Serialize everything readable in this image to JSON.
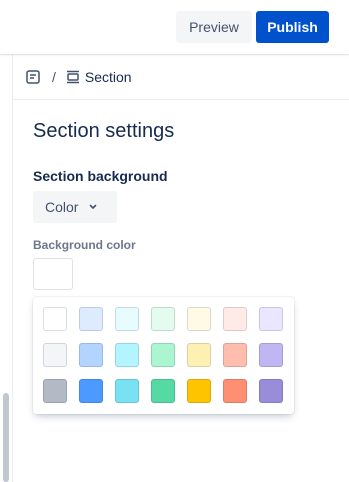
{
  "toolbar": {
    "preview_label": "Preview",
    "publish_label": "Publish"
  },
  "breadcrumb": {
    "page_icon": "page-icon",
    "separator": "/",
    "section_icon": "section-icon",
    "section_label": "Section"
  },
  "panel": {
    "title": "Section settings",
    "background_heading": "Section background",
    "background_type": "Color",
    "background_color_label": "Background color"
  },
  "palette": {
    "rows": [
      [
        "#ffffff",
        "#deebff",
        "#e6fcff",
        "#e3fcef",
        "#fffae6",
        "#ffebe6",
        "#eae6ff"
      ],
      [
        "#f4f5f7",
        "#b3d4ff",
        "#b3f5ff",
        "#abf5d1",
        "#fff0b3",
        "#ffbdad",
        "#c0b6f2"
      ],
      [
        "#b3bac5",
        "#4c9aff",
        "#79e2f2",
        "#57d9a3",
        "#ffc400",
        "#ff8f73",
        "#998dd9"
      ]
    ]
  },
  "colors": {
    "primary": "#0052cc",
    "text": "#172b4d",
    "subtle": "#6b778c"
  }
}
